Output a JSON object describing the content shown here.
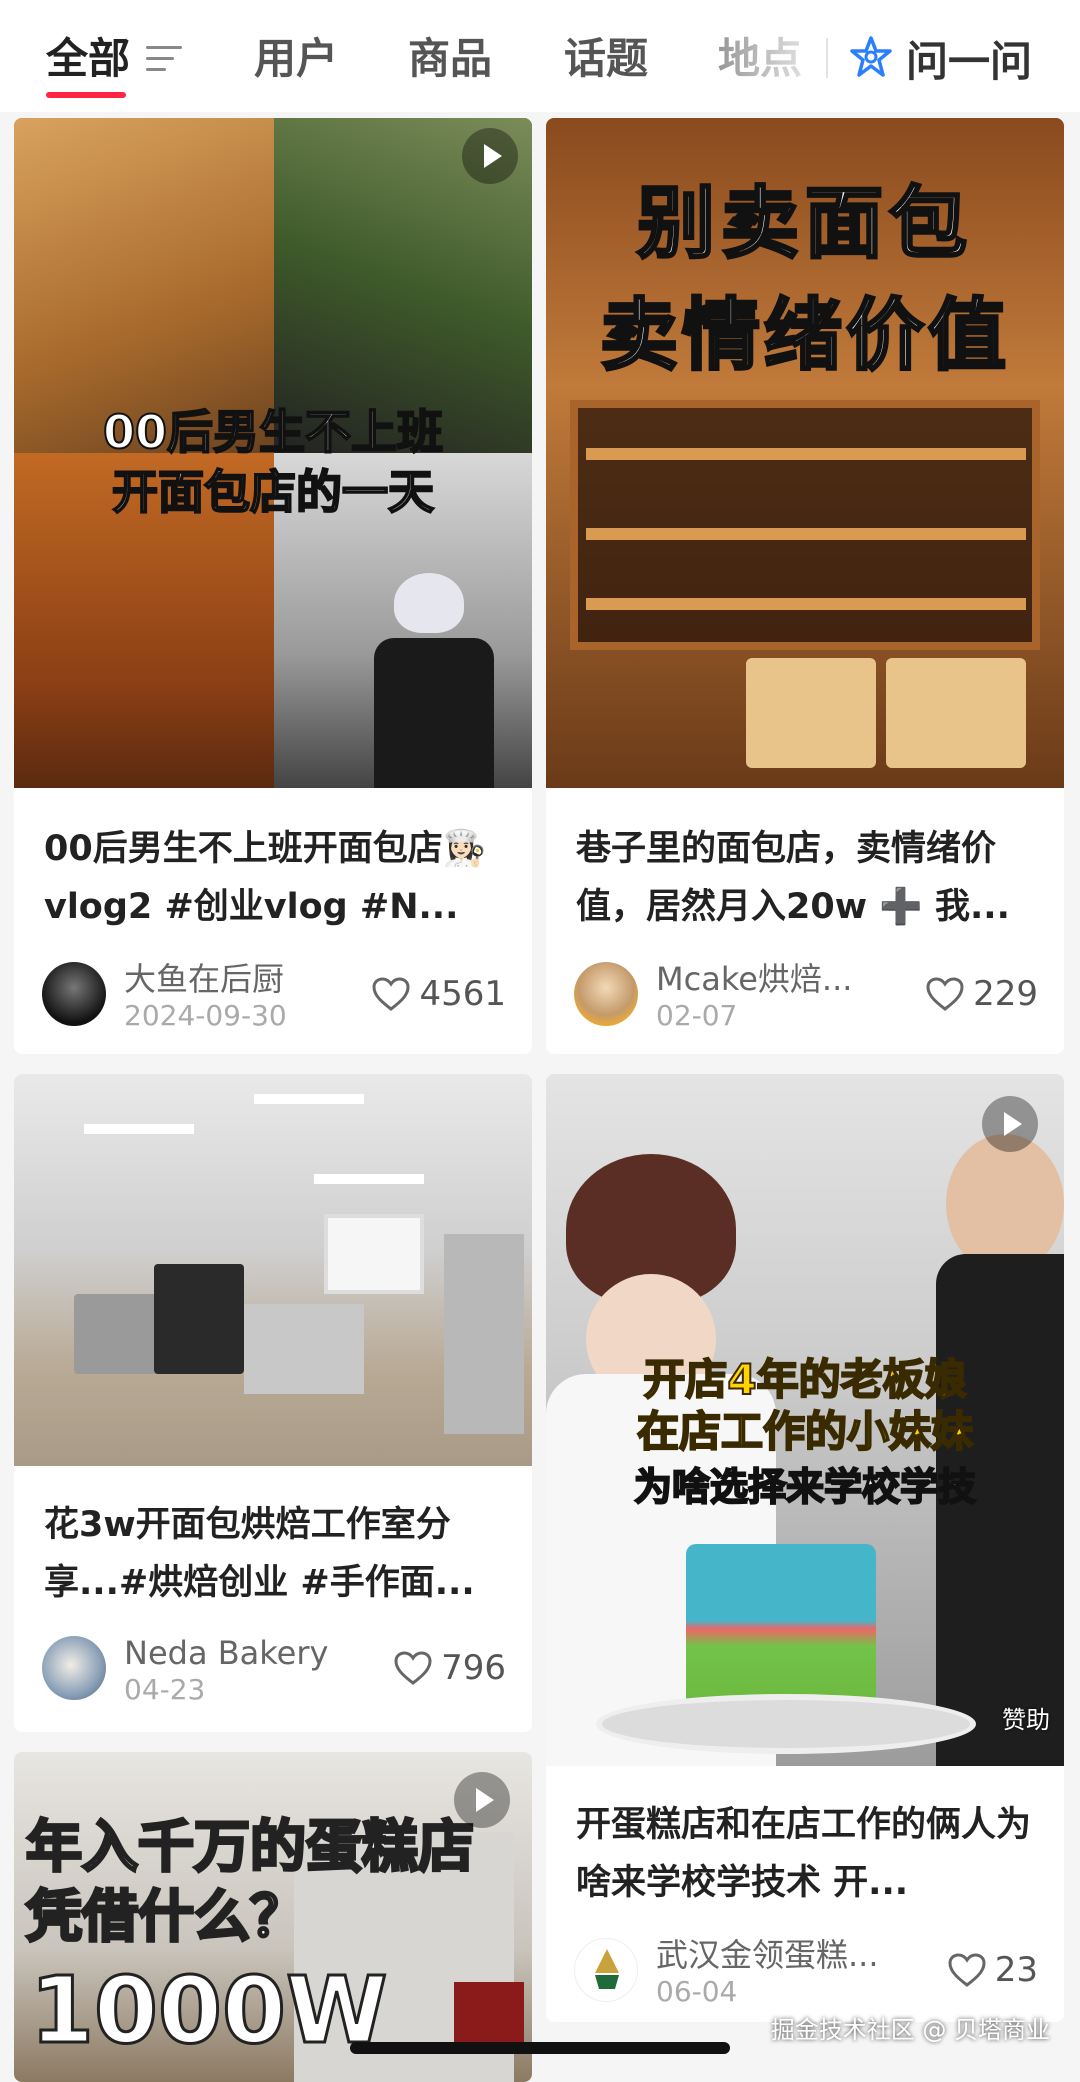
{
  "tabs": [
    {
      "label": "全部",
      "active": true
    },
    {
      "label": "用户"
    },
    {
      "label": "商品"
    },
    {
      "label": "话题"
    },
    {
      "label": "地点"
    }
  ],
  "ask_button": {
    "label": "问一问",
    "icon": "ai-star-icon"
  },
  "posts": [
    {
      "cover_text": [
        "00后男生不上班",
        "开面包店的一天"
      ],
      "title": "00后男生不上班开面包店👩🏻‍🍳vlog2 #创业vlog #N...",
      "author": "大鱼在后厨",
      "date": "2024-09-30",
      "likes": "4561",
      "is_video": true
    },
    {
      "cover_text": [
        "别卖面包",
        "卖情绪价值"
      ],
      "title": "巷子里的面包店，卖情绪价值，居然月入20w ➕ 我...",
      "author": "Mcake烘焙...",
      "date": "02-07",
      "likes": "229",
      "is_video": false
    },
    {
      "cover_text": [],
      "title": "花3w开面包烘焙工作室分享...#烘焙创业 #手作面...",
      "author": "Neda Bakery",
      "date": "04-23",
      "likes": "796",
      "is_video": false
    },
    {
      "cover_text": [
        "开店4年的老板娘",
        "在店工作的小妹妹",
        "为啥选择来学校学技"
      ],
      "cover_badge": "赞助",
      "title": "开蛋糕店和在店工作的俩人为啥来学校学技术 开...",
      "author": "武汉金领蛋糕...",
      "date": "06-04",
      "likes": "23",
      "is_video": true
    },
    {
      "cover_text": [
        "年入千万的蛋糕店",
        "凭借什么？",
        "1000W"
      ],
      "is_video": true
    }
  ],
  "watermark": "掘金技术社区 @ 贝塔商业",
  "colors": {
    "accent": "#ff2442",
    "ask_blue": "#2b7fff"
  }
}
